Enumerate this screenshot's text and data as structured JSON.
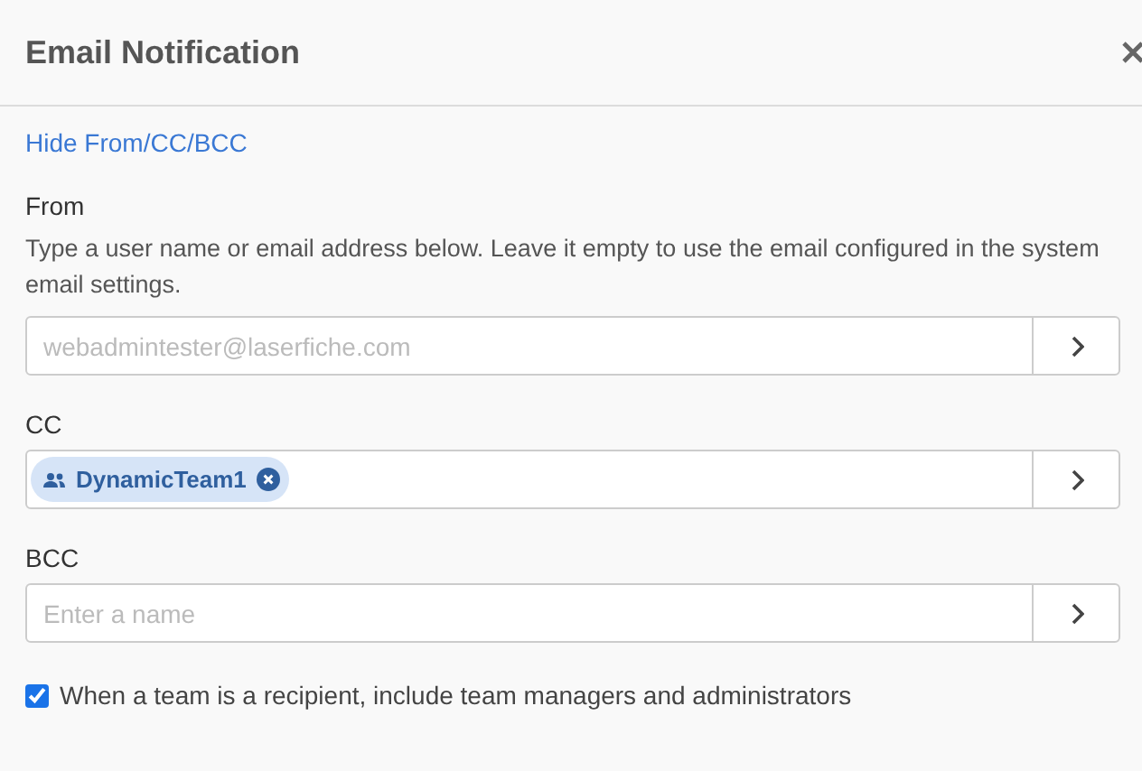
{
  "dialog": {
    "title": "Email Notification",
    "toggle_link": "Hide From/CC/BCC",
    "fields": [
      {
        "label": "From",
        "description": "Type a user name or email address below. Leave it empty to use the email configured in the system email settings.",
        "placeholder": "webadmintester@laserfiche.com"
      },
      {
        "label": "CC",
        "tokens": [
          {
            "kind": "team",
            "label": "DynamicTeam1"
          }
        ]
      },
      {
        "label": "BCC",
        "placeholder": "Enter a name"
      }
    ],
    "include_managers": {
      "label": "When a team is a recipient, include team managers and administrators",
      "checked": true
    }
  }
}
